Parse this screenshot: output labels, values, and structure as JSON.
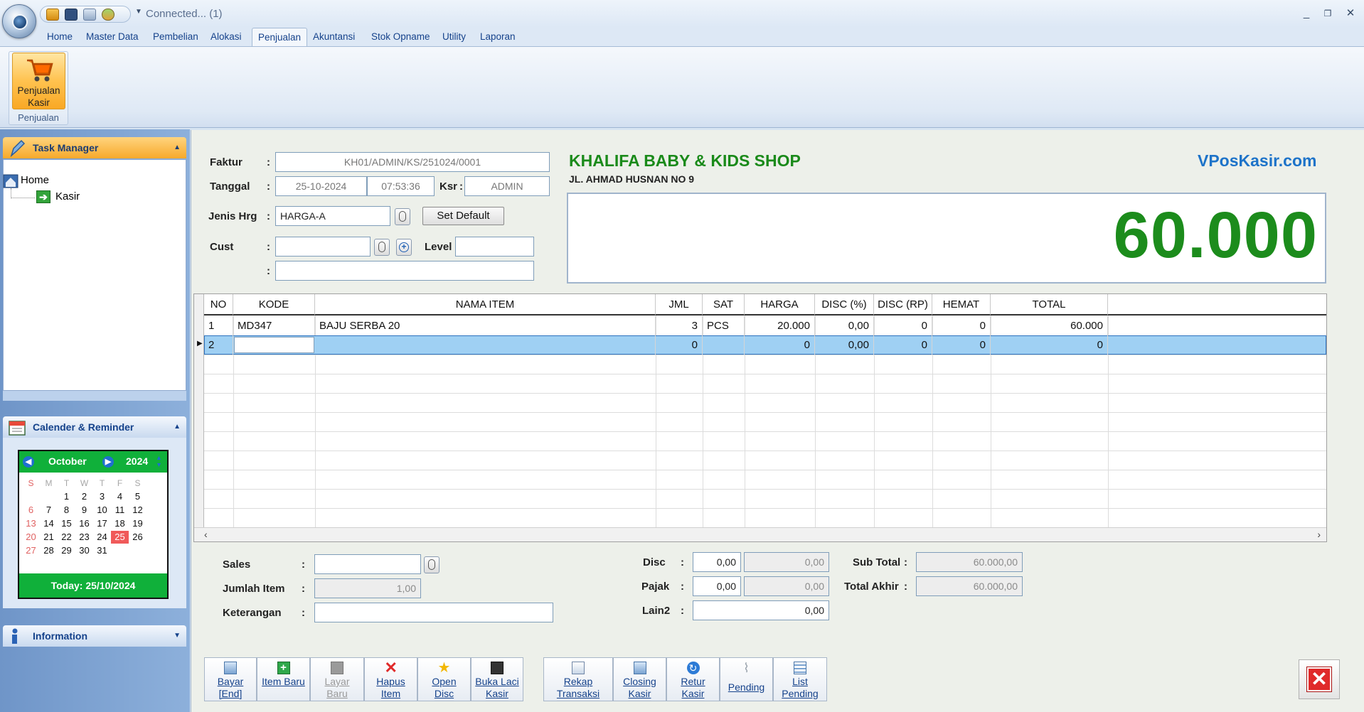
{
  "titlebar": {
    "connection": "Connected... (1)"
  },
  "ribbon": {
    "tabs": [
      "Home",
      "Master Data",
      "Pembelian",
      "Alokasi",
      "Penjualan",
      "Akuntansi",
      "Stok Opname",
      "Utility",
      "Laporan"
    ],
    "active_tab": "Penjualan",
    "button_kasir": "Penjualan\nKasir",
    "group_label": "Penjualan"
  },
  "task_manager": {
    "title": "Task Manager",
    "items": [
      "Home",
      "Kasir"
    ]
  },
  "calendar": {
    "title": "Calender & Reminder",
    "month": "October",
    "year": "2024",
    "dow": [
      "S",
      "M",
      "T",
      "W",
      "T",
      "F",
      "S"
    ],
    "today_label": "Today: 25/10/2024",
    "today_day": 25
  },
  "information": {
    "title": "Information"
  },
  "form": {
    "faktur_label": "Faktur",
    "faktur_value": "KH01/ADMIN/KS/251024/0001",
    "tanggal_label": "Tanggal",
    "tanggal_value": "25-10-2024",
    "time_value": "07:53:36",
    "ksr_label": "Ksr",
    "ksr_value": "ADMIN",
    "jenis_label": "Jenis Hrg",
    "jenis_value": "HARGA-A",
    "set_default": "Set Default",
    "cust_label": "Cust",
    "level_label": "Level"
  },
  "shop": {
    "name": "KHALIFA BABY & KIDS SHOP",
    "address": "JL. AHMAD HUSNAN NO 9",
    "brand": "VPosKasir.com",
    "total_display": "60.000"
  },
  "grid": {
    "columns": [
      "NO",
      "KODE",
      "NAMA ITEM",
      "JML",
      "SAT",
      "HARGA",
      "DISC (%)",
      "DISC (RP)",
      "HEMAT",
      "TOTAL"
    ],
    "rows": [
      [
        "1",
        "MD347",
        "BAJU SERBA 20",
        "3",
        "PCS",
        "20.000",
        "0,00",
        "0",
        "0",
        "60.000"
      ],
      [
        "2",
        "",
        "",
        "0",
        "",
        "0",
        "0,00",
        "0",
        "0",
        "0"
      ]
    ]
  },
  "footer": {
    "sales_label": "Sales",
    "jumlah_label": "Jumlah Item",
    "jumlah_value": "1,00",
    "ket_label": "Keterangan",
    "disc_label": "Disc",
    "disc_pct": "0,00",
    "disc_val": "0,00",
    "pajak_label": "Pajak",
    "pajak_pct": "0,00",
    "pajak_val": "0,00",
    "lain_label": "Lain2",
    "lain_val": "0,00",
    "subtotal_label": "Sub Total",
    "subtotal_val": "60.000,00",
    "totalakhir_label": "Total Akhir",
    "totalakhir_val": "60.000,00"
  },
  "toolbar": {
    "bayar": "Bayar\n[End]",
    "item_baru": "Item Baru",
    "layar_baru": "Layar\nBaru",
    "hapus_item": "Hapus\nItem",
    "open_disc": "Open\nDisc",
    "buka_laci": "Buka Laci\nKasir",
    "rekap": "Rekap\nTransaksi",
    "closing": "Closing\nKasir",
    "retur": "Retur\nKasir",
    "pending": "Pending",
    "list_pending": "List\nPending"
  },
  "colors": {
    "accent_green": "#1c8c1c",
    "brand_blue": "#1d73c9",
    "ribbon_orange": "#f9a825"
  }
}
